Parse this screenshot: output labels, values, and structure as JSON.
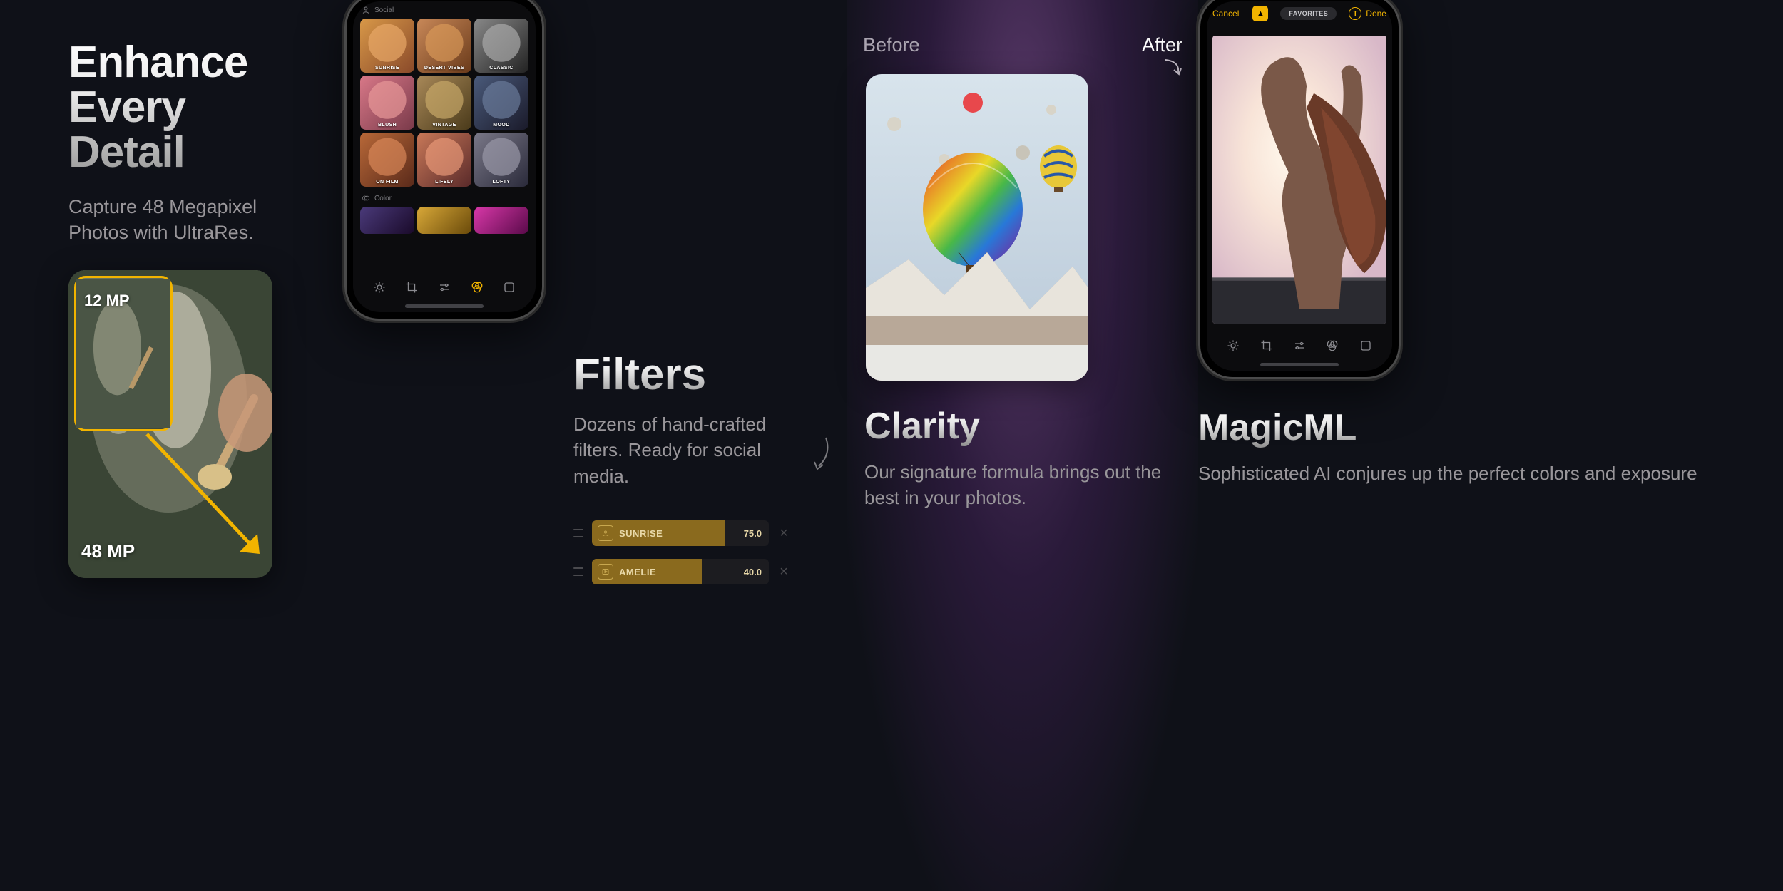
{
  "panel1": {
    "title_l1": "Enhance",
    "title_l2": "Every",
    "title_l3": "Detail",
    "subtitle": "Capture 48 Megapixel Photos with UltraRes.",
    "inset_label": "12 MP",
    "full_label": "48 MP"
  },
  "panel2": {
    "section_social": "Social",
    "section_color": "Color",
    "filters_row1": [
      "SUNRISE",
      "DESERT VIBES",
      "CLASSIC"
    ],
    "filters_row2": [
      "BLUSH",
      "VINTAGE",
      "MOOD"
    ],
    "filters_row3": [
      "ON FILM",
      "LIFELY",
      "LOFTY"
    ]
  },
  "panel3": {
    "title": "Filters",
    "subtitle": "Dozens of hand-crafted filters. Ready for social media.",
    "sliders": [
      {
        "name": "SUNRISE",
        "value": "75.0",
        "fill_pct": 75
      },
      {
        "name": "AMELIE",
        "value": "40.0",
        "fill_pct": 62
      }
    ]
  },
  "panel4": {
    "before": "Before",
    "after": "After",
    "title": "Clarity",
    "subtitle": "Our signature formula brings out the best in your photos."
  },
  "panel5": {
    "topbar": {
      "cancel": "Cancel",
      "favorites": "FAVORITES",
      "t_label": "T",
      "done": "Done"
    },
    "title": "MagicML",
    "subtitle": "Sophisticated AI conjures up the perfect colors and exposure"
  }
}
